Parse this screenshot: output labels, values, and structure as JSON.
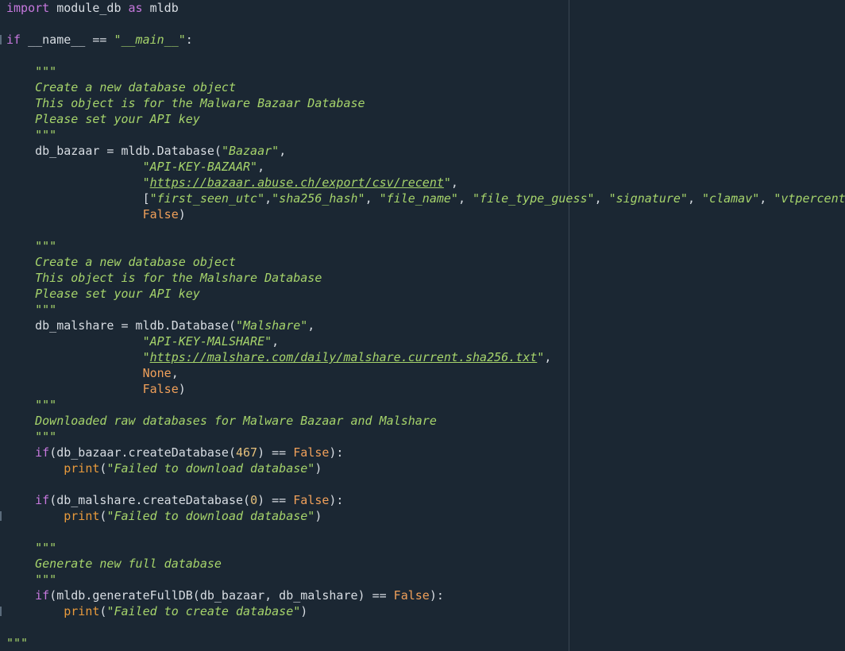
{
  "editor": {
    "lines": [
      [
        {
          "t": "import",
          "c": "kw"
        },
        {
          "t": " module_db ",
          "c": "op"
        },
        {
          "t": "as",
          "c": "kw"
        },
        {
          "t": " mldb",
          "c": "op"
        }
      ],
      [],
      [
        {
          "t": "if",
          "c": "kw"
        },
        {
          "t": " __name__ == ",
          "c": "op"
        },
        {
          "t": "\"__main__\"",
          "c": "str"
        },
        {
          "t": ":",
          "c": "op"
        }
      ],
      [],
      [
        {
          "t": "    \"\"\"",
          "c": "com"
        }
      ],
      [
        {
          "t": "    Create a new database object",
          "c": "com"
        }
      ],
      [
        {
          "t": "    This object is for the Malware Bazaar Database",
          "c": "com"
        }
      ],
      [
        {
          "t": "    Please set your API key",
          "c": "com"
        }
      ],
      [
        {
          "t": "    \"\"\"",
          "c": "com"
        }
      ],
      [
        {
          "t": "    db_bazaar = mldb.Database(",
          "c": "op"
        },
        {
          "t": "\"Bazaar\"",
          "c": "str"
        },
        {
          "t": ",",
          "c": "op"
        }
      ],
      [
        {
          "t": "                   ",
          "c": "op"
        },
        {
          "t": "\"API-KEY-BAZAAR\"",
          "c": "str"
        },
        {
          "t": ",",
          "c": "op"
        }
      ],
      [
        {
          "t": "                   ",
          "c": "op"
        },
        {
          "t": "\"",
          "c": "str"
        },
        {
          "t": "https://bazaar.abuse.ch/export/csv/recent",
          "c": "url"
        },
        {
          "t": "\"",
          "c": "str"
        },
        {
          "t": ",",
          "c": "op"
        }
      ],
      [
        {
          "t": "                   [",
          "c": "op"
        },
        {
          "t": "\"first_seen_utc\"",
          "c": "str"
        },
        {
          "t": ",",
          "c": "op"
        },
        {
          "t": "\"sha256_hash\"",
          "c": "str"
        },
        {
          "t": ", ",
          "c": "op"
        },
        {
          "t": "\"file_name\"",
          "c": "str"
        },
        {
          "t": ", ",
          "c": "op"
        },
        {
          "t": "\"file_type_guess\"",
          "c": "str"
        },
        {
          "t": ", ",
          "c": "op"
        },
        {
          "t": "\"signature\"",
          "c": "str"
        },
        {
          "t": ", ",
          "c": "op"
        },
        {
          "t": "\"clamav\"",
          "c": "str"
        },
        {
          "t": ", ",
          "c": "op"
        },
        {
          "t": "\"vtpercent\"",
          "c": "str"
        }
      ],
      [
        {
          "t": "                   ",
          "c": "op"
        },
        {
          "t": "False",
          "c": "bool"
        },
        {
          "t": ")",
          "c": "op"
        }
      ],
      [],
      [
        {
          "t": "    \"\"\"",
          "c": "com"
        }
      ],
      [
        {
          "t": "    Create a new database object",
          "c": "com"
        }
      ],
      [
        {
          "t": "    This object is for the Malshare Database",
          "c": "com"
        }
      ],
      [
        {
          "t": "    Please set your API key",
          "c": "com"
        }
      ],
      [
        {
          "t": "    \"\"\"",
          "c": "com"
        }
      ],
      [
        {
          "t": "    db_malshare = mldb.Database(",
          "c": "op"
        },
        {
          "t": "\"Malshare\"",
          "c": "str"
        },
        {
          "t": ",",
          "c": "op"
        }
      ],
      [
        {
          "t": "                   ",
          "c": "op"
        },
        {
          "t": "\"API-KEY-MALSHARE\"",
          "c": "str"
        },
        {
          "t": ",",
          "c": "op"
        }
      ],
      [
        {
          "t": "                   ",
          "c": "op"
        },
        {
          "t": "\"",
          "c": "str"
        },
        {
          "t": "https://malshare.com/daily/malshare.current.sha256.txt",
          "c": "url"
        },
        {
          "t": "\"",
          "c": "str"
        },
        {
          "t": ",",
          "c": "op"
        }
      ],
      [
        {
          "t": "                   ",
          "c": "op"
        },
        {
          "t": "None",
          "c": "bool"
        },
        {
          "t": ",",
          "c": "op"
        }
      ],
      [
        {
          "t": "                   ",
          "c": "op"
        },
        {
          "t": "False",
          "c": "bool"
        },
        {
          "t": ")",
          "c": "op"
        }
      ],
      [
        {
          "t": "    \"\"\"",
          "c": "com"
        }
      ],
      [
        {
          "t": "    Downloaded raw databases for Malware Bazaar and Malshare",
          "c": "com"
        }
      ],
      [
        {
          "t": "    \"\"\"",
          "c": "com"
        }
      ],
      [
        {
          "t": "    ",
          "c": "op"
        },
        {
          "t": "if",
          "c": "kw"
        },
        {
          "t": "(db_bazaar.createDatabase(",
          "c": "op"
        },
        {
          "t": "467",
          "c": "num"
        },
        {
          "t": ") == ",
          "c": "op"
        },
        {
          "t": "False",
          "c": "bool"
        },
        {
          "t": "):",
          "c": "op"
        }
      ],
      [
        {
          "t": "        ",
          "c": "op"
        },
        {
          "t": "print",
          "c": "bi"
        },
        {
          "t": "(",
          "c": "op"
        },
        {
          "t": "\"Failed to download database\"",
          "c": "str"
        },
        {
          "t": ")",
          "c": "op"
        }
      ],
      [],
      [
        {
          "t": "    ",
          "c": "op"
        },
        {
          "t": "if",
          "c": "kw"
        },
        {
          "t": "(db_malshare.createDatabase(",
          "c": "op"
        },
        {
          "t": "0",
          "c": "num"
        },
        {
          "t": ") == ",
          "c": "op"
        },
        {
          "t": "False",
          "c": "bool"
        },
        {
          "t": "):",
          "c": "op"
        }
      ],
      [
        {
          "t": "        ",
          "c": "op"
        },
        {
          "t": "print",
          "c": "bi"
        },
        {
          "t": "(",
          "c": "op"
        },
        {
          "t": "\"Failed to download database\"",
          "c": "str"
        },
        {
          "t": ")",
          "c": "op"
        }
      ],
      [],
      [
        {
          "t": "    \"\"\"",
          "c": "com"
        }
      ],
      [
        {
          "t": "    Generate new full database",
          "c": "com"
        }
      ],
      [
        {
          "t": "    \"\"\"",
          "c": "com"
        }
      ],
      [
        {
          "t": "    ",
          "c": "op"
        },
        {
          "t": "if",
          "c": "kw"
        },
        {
          "t": "(mldb.generateFullDB(db_bazaar, db_malshare) == ",
          "c": "op"
        },
        {
          "t": "False",
          "c": "bool"
        },
        {
          "t": "):",
          "c": "op"
        }
      ],
      [
        {
          "t": "        ",
          "c": "op"
        },
        {
          "t": "print",
          "c": "bi"
        },
        {
          "t": "(",
          "c": "op"
        },
        {
          "t": "\"Failed to create database\"",
          "c": "str"
        },
        {
          "t": ")",
          "c": "op"
        }
      ],
      [],
      [
        {
          "t": "\"\"\"",
          "c": "com"
        }
      ]
    ]
  }
}
